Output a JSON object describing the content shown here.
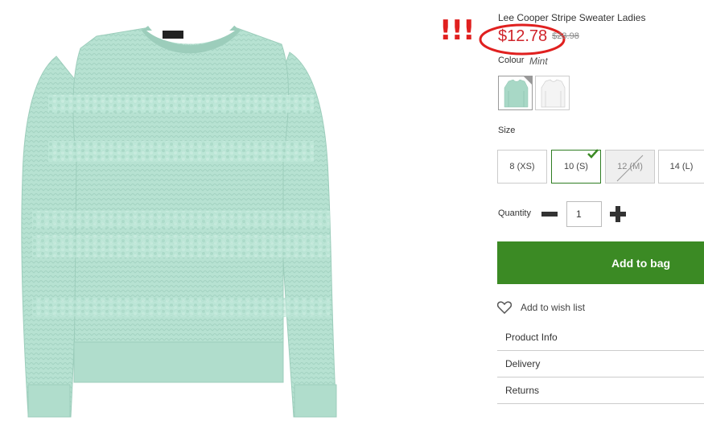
{
  "annotation": {
    "text": "!!!",
    "color": "#e0201f"
  },
  "product": {
    "title": "Lee Cooper Stripe Sweater Ladies",
    "price_now": "$12.78",
    "price_was": "$23.98",
    "image_color": "#b9e4d5"
  },
  "colour": {
    "label": "Colour",
    "value": "Mint",
    "swatches": [
      {
        "name": "Mint",
        "color": "#a8d8c6",
        "selected": true
      },
      {
        "name": "White",
        "color": "#f4f4f4",
        "selected": false
      }
    ]
  },
  "size": {
    "label": "Size",
    "options": [
      {
        "label": "8 (XS)",
        "state": "available"
      },
      {
        "label": "10 (S)",
        "state": "selected"
      },
      {
        "label": "12 (M)",
        "state": "unavailable"
      },
      {
        "label": "14 (L)",
        "state": "available"
      }
    ]
  },
  "quantity": {
    "label": "Quantity",
    "value": "1"
  },
  "actions": {
    "add_to_bag": "Add to bag",
    "wishlist": "Add to wish list"
  },
  "accordion": [
    "Product Info",
    "Delivery",
    "Returns"
  ],
  "colors": {
    "accent_green": "#3b8a24",
    "price_red": "#d0242b",
    "annotation_red": "#e0201f"
  }
}
